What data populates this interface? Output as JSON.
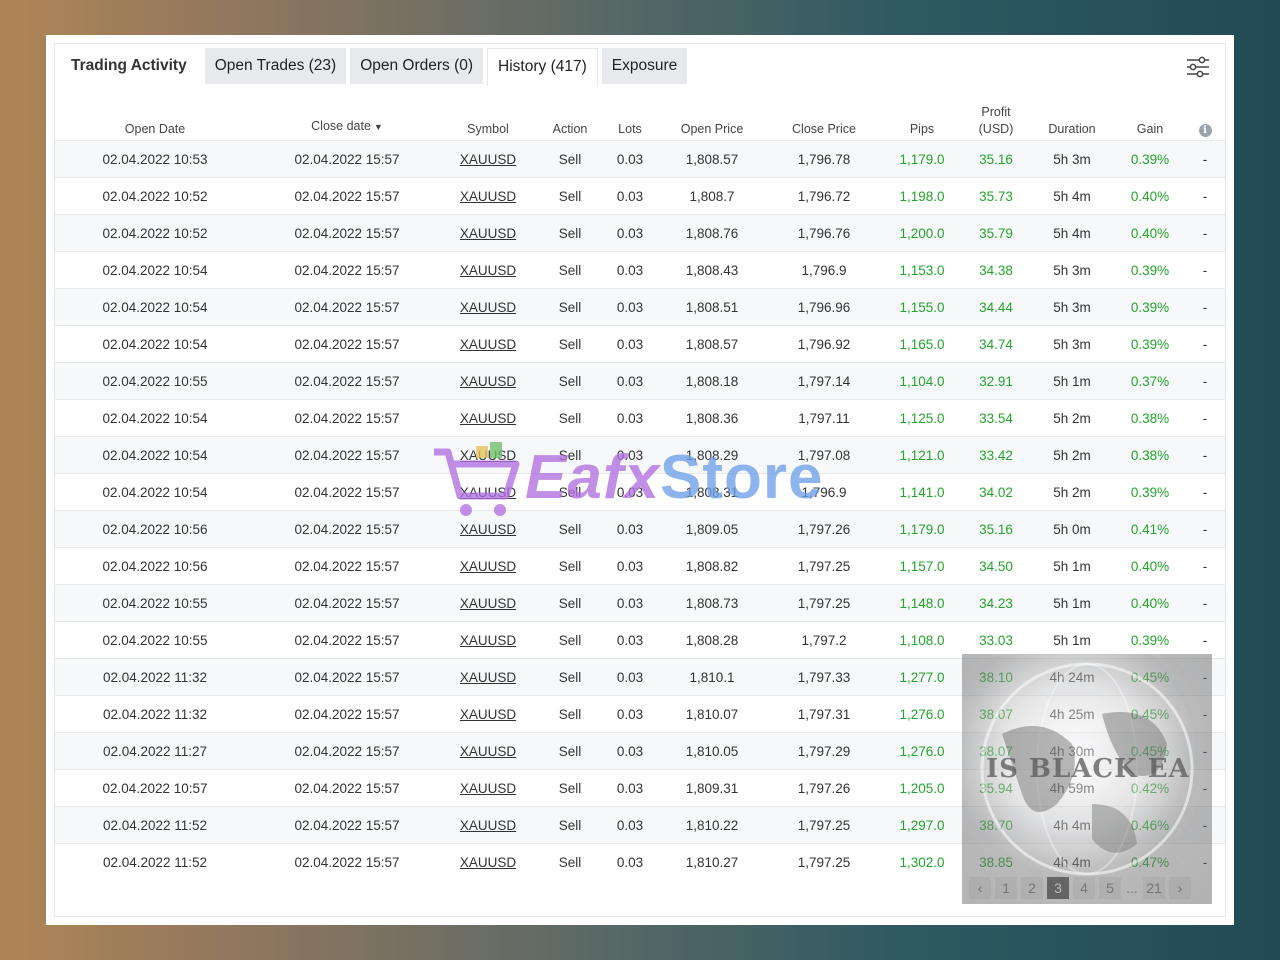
{
  "tabs": {
    "title": "Trading Activity",
    "open_trades": "Open Trades (23)",
    "open_orders": "Open Orders (0)",
    "history": "History (417)",
    "exposure": "Exposure"
  },
  "table": {
    "headers": {
      "open_date": "Open Date",
      "close_date": "Close date",
      "symbol": "Symbol",
      "action": "Action",
      "lots": "Lots",
      "open_price": "Open Price",
      "close_price": "Close Price",
      "pips": "Pips",
      "profit_line1": "Profit",
      "profit_line2": "(USD)",
      "duration": "Duration",
      "gain": "Gain"
    },
    "rows": [
      [
        "02.04.2022 10:53",
        "02.04.2022 15:57",
        "XAUUSD",
        "Sell",
        "0.03",
        "1,808.57",
        "1,796.78",
        "1,179.0",
        "35.16",
        "5h 3m",
        "0.39%",
        "-"
      ],
      [
        "02.04.2022 10:52",
        "02.04.2022 15:57",
        "XAUUSD",
        "Sell",
        "0.03",
        "1,808.7",
        "1,796.72",
        "1,198.0",
        "35.73",
        "5h 4m",
        "0.40%",
        "-"
      ],
      [
        "02.04.2022 10:52",
        "02.04.2022 15:57",
        "XAUUSD",
        "Sell",
        "0.03",
        "1,808.76",
        "1,796.76",
        "1,200.0",
        "35.79",
        "5h 4m",
        "0.40%",
        "-"
      ],
      [
        "02.04.2022 10:54",
        "02.04.2022 15:57",
        "XAUUSD",
        "Sell",
        "0.03",
        "1,808.43",
        "1,796.9",
        "1,153.0",
        "34.38",
        "5h 3m",
        "0.39%",
        "-"
      ],
      [
        "02.04.2022 10:54",
        "02.04.2022 15:57",
        "XAUUSD",
        "Sell",
        "0.03",
        "1,808.51",
        "1,796.96",
        "1,155.0",
        "34.44",
        "5h 3m",
        "0.39%",
        "-"
      ],
      [
        "02.04.2022 10:54",
        "02.04.2022 15:57",
        "XAUUSD",
        "Sell",
        "0.03",
        "1,808.57",
        "1,796.92",
        "1,165.0",
        "34.74",
        "5h 3m",
        "0.39%",
        "-"
      ],
      [
        "02.04.2022 10:55",
        "02.04.2022 15:57",
        "XAUUSD",
        "Sell",
        "0.03",
        "1,808.18",
        "1,797.14",
        "1,104.0",
        "32.91",
        "5h 1m",
        "0.37%",
        "-"
      ],
      [
        "02.04.2022 10:54",
        "02.04.2022 15:57",
        "XAUUSD",
        "Sell",
        "0.03",
        "1,808.36",
        "1,797.11",
        "1,125.0",
        "33.54",
        "5h 2m",
        "0.38%",
        "-"
      ],
      [
        "02.04.2022 10:54",
        "02.04.2022 15:57",
        "XAUUSD",
        "Sell",
        "0.03",
        "1,808.29",
        "1,797.08",
        "1,121.0",
        "33.42",
        "5h 2m",
        "0.38%",
        "-"
      ],
      [
        "02.04.2022 10:54",
        "02.04.2022 15:57",
        "XAUUSD",
        "Sell",
        "0.03",
        "1,808.31",
        "1,796.9",
        "1,141.0",
        "34.02",
        "5h 2m",
        "0.39%",
        "-"
      ],
      [
        "02.04.2022 10:56",
        "02.04.2022 15:57",
        "XAUUSD",
        "Sell",
        "0.03",
        "1,809.05",
        "1,797.26",
        "1,179.0",
        "35.16",
        "5h 0m",
        "0.41%",
        "-"
      ],
      [
        "02.04.2022 10:56",
        "02.04.2022 15:57",
        "XAUUSD",
        "Sell",
        "0.03",
        "1,808.82",
        "1,797.25",
        "1,157.0",
        "34.50",
        "5h 1m",
        "0.40%",
        "-"
      ],
      [
        "02.04.2022 10:55",
        "02.04.2022 15:57",
        "XAUUSD",
        "Sell",
        "0.03",
        "1,808.73",
        "1,797.25",
        "1,148.0",
        "34.23",
        "5h 1m",
        "0.40%",
        "-"
      ],
      [
        "02.04.2022 10:55",
        "02.04.2022 15:57",
        "XAUUSD",
        "Sell",
        "0.03",
        "1,808.28",
        "1,797.2",
        "1,108.0",
        "33.03",
        "5h 1m",
        "0.39%",
        "-"
      ],
      [
        "02.04.2022 11:32",
        "02.04.2022 15:57",
        "XAUUSD",
        "Sell",
        "0.03",
        "1,810.1",
        "1,797.33",
        "1,277.0",
        "38.10",
        "4h 24m",
        "0.45%",
        "-"
      ],
      [
        "02.04.2022 11:32",
        "02.04.2022 15:57",
        "XAUUSD",
        "Sell",
        "0.03",
        "1,810.07",
        "1,797.31",
        "1,276.0",
        "38.07",
        "4h 25m",
        "0.45%",
        "-"
      ],
      [
        "02.04.2022 11:27",
        "02.04.2022 15:57",
        "XAUUSD",
        "Sell",
        "0.03",
        "1,810.05",
        "1,797.29",
        "1,276.0",
        "38.07",
        "4h 30m",
        "0.45%",
        "-"
      ],
      [
        "02.04.2022 10:57",
        "02.04.2022 15:57",
        "XAUUSD",
        "Sell",
        "0.03",
        "1,809.31",
        "1,797.26",
        "1,205.0",
        "35.94",
        "4h 59m",
        "0.42%",
        "-"
      ],
      [
        "02.04.2022 11:52",
        "02.04.2022 15:57",
        "XAUUSD",
        "Sell",
        "0.03",
        "1,810.22",
        "1,797.25",
        "1,297.0",
        "38.70",
        "4h 4m",
        "0.46%",
        "-"
      ],
      [
        "02.04.2022 11:52",
        "02.04.2022 15:57",
        "XAUUSD",
        "Sell",
        "0.03",
        "1,810.27",
        "1,797.25",
        "1,302.0",
        "38.85",
        "4h 4m",
        "0.47%",
        "-"
      ]
    ]
  },
  "pagination": {
    "prev": "‹",
    "pages": [
      "1",
      "2",
      "3",
      "4",
      "5"
    ],
    "current": "3",
    "ellipsis": "...",
    "last": "21",
    "next": "›"
  },
  "watermarks": {
    "store_left": "Eafx",
    "store_right": "Store",
    "globe_label": "IS BLACK EA"
  },
  "colors": {
    "positive": "#22a52a",
    "tab_bg": "#e7e9ec",
    "active_page": "#555555"
  },
  "icons": {
    "settings": "sliders-icon",
    "info": "info-icon",
    "cart": "cart-icon"
  }
}
